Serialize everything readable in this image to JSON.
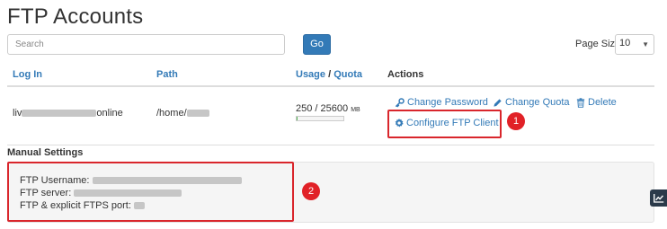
{
  "page": {
    "title": "FTP Accounts"
  },
  "search": {
    "placeholder": "Search",
    "go_label": "Go"
  },
  "pagination": {
    "page_size_label": "Page Size",
    "page_size_value": "10"
  },
  "table": {
    "columns": {
      "login": "Log In",
      "path": "Path",
      "usage": "Usage",
      "usage_sep": " / ",
      "quota": "Quota",
      "actions": "Actions"
    },
    "rows": [
      {
        "login_prefix": "liv",
        "login_suffix": "online",
        "path_prefix": "/home/",
        "usage": "250 / 25600",
        "usage_unit": "MB",
        "usage_fraction": 0.0098,
        "actions": {
          "change_password": "Change Password",
          "change_quota": "Change Quota",
          "delete": "Delete",
          "configure": "Configure FTP Client"
        }
      }
    ]
  },
  "manual_settings": {
    "title": "Manual Settings",
    "username_label": "FTP Username:",
    "server_label": "FTP server:",
    "port_label": "FTP & explicit FTPS port:"
  },
  "callouts": {
    "first": "1",
    "second": "2"
  },
  "colors": {
    "link": "#337ab7",
    "callout": "#e12127",
    "button": "#337ab7"
  },
  "icons": {
    "change_password": "key-icon",
    "change_quota": "pencil-icon",
    "delete": "trash-icon",
    "configure": "gear-icon",
    "stats": "chart-line-icon"
  }
}
